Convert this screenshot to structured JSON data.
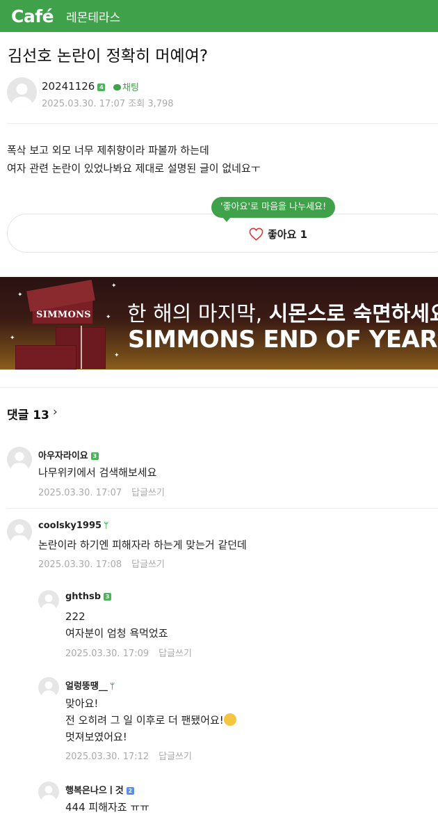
{
  "header": {
    "logo": "Café",
    "cafe_name": "레몬테라스",
    "brand_color": "#3fa24a"
  },
  "post": {
    "title": "김선호 논란이 정확히 머예여?",
    "author": "20241126",
    "author_level": "4",
    "chat_label": "채팅",
    "date": "2025.03.30. 17:07",
    "views": "조회 3,798",
    "body_line1": "폭삭 보고 외모 너무 제취향이라 파볼까 하는데",
    "body_line2": "여자 관련 논란이 있었나봐요 제대로 설명된 글이 없네요ㅜ",
    "like_tooltip": "'좋아요'로 마음을 나누세요!",
    "like_label": "좋아요 1"
  },
  "ad": {
    "brand": "SIMMONS",
    "line1_part1": "한 해의 마지막, ",
    "line1_part2": "시몬스로 숙면하세요",
    "line2": "SIMMONS END OF YEAR"
  },
  "comments_header": {
    "label": "댓글 13",
    "arrow": "›"
  },
  "comments": [
    {
      "name": "아우자라이요",
      "level": "3",
      "lines": [
        "나무위키에서 검색해보세요"
      ],
      "date": "2025.03.30. 17:07",
      "reply": "답글쓰기"
    },
    {
      "name": "coolsky1995",
      "level": "",
      "lines": [
        "논란이라 하기엔 피해자라 하는게 맞는거 같던데"
      ],
      "date": "2025.03.30. 17:08",
      "reply": "답글쓰기"
    },
    {
      "name": "ghthsb",
      "level": "3",
      "lines": [
        "222",
        "여자분이 엄청 욕먹었죠"
      ],
      "date": "2025.03.30. 17:09",
      "reply": "답글쓰기"
    },
    {
      "name": "얼렁뚱땡__",
      "level": "",
      "lines": [
        "맞아요!",
        "전 오히려 그 일 이후로 더 팬됐어요!",
        "멋져보였어요!"
      ],
      "date": "2025.03.30. 17:12",
      "reply": "답글쓰기"
    },
    {
      "name": "행복은나으ㅣ것",
      "level": "2",
      "lines": [
        "444 피해자죠 ㅠㅠ"
      ],
      "date": "",
      "reply": ""
    }
  ]
}
